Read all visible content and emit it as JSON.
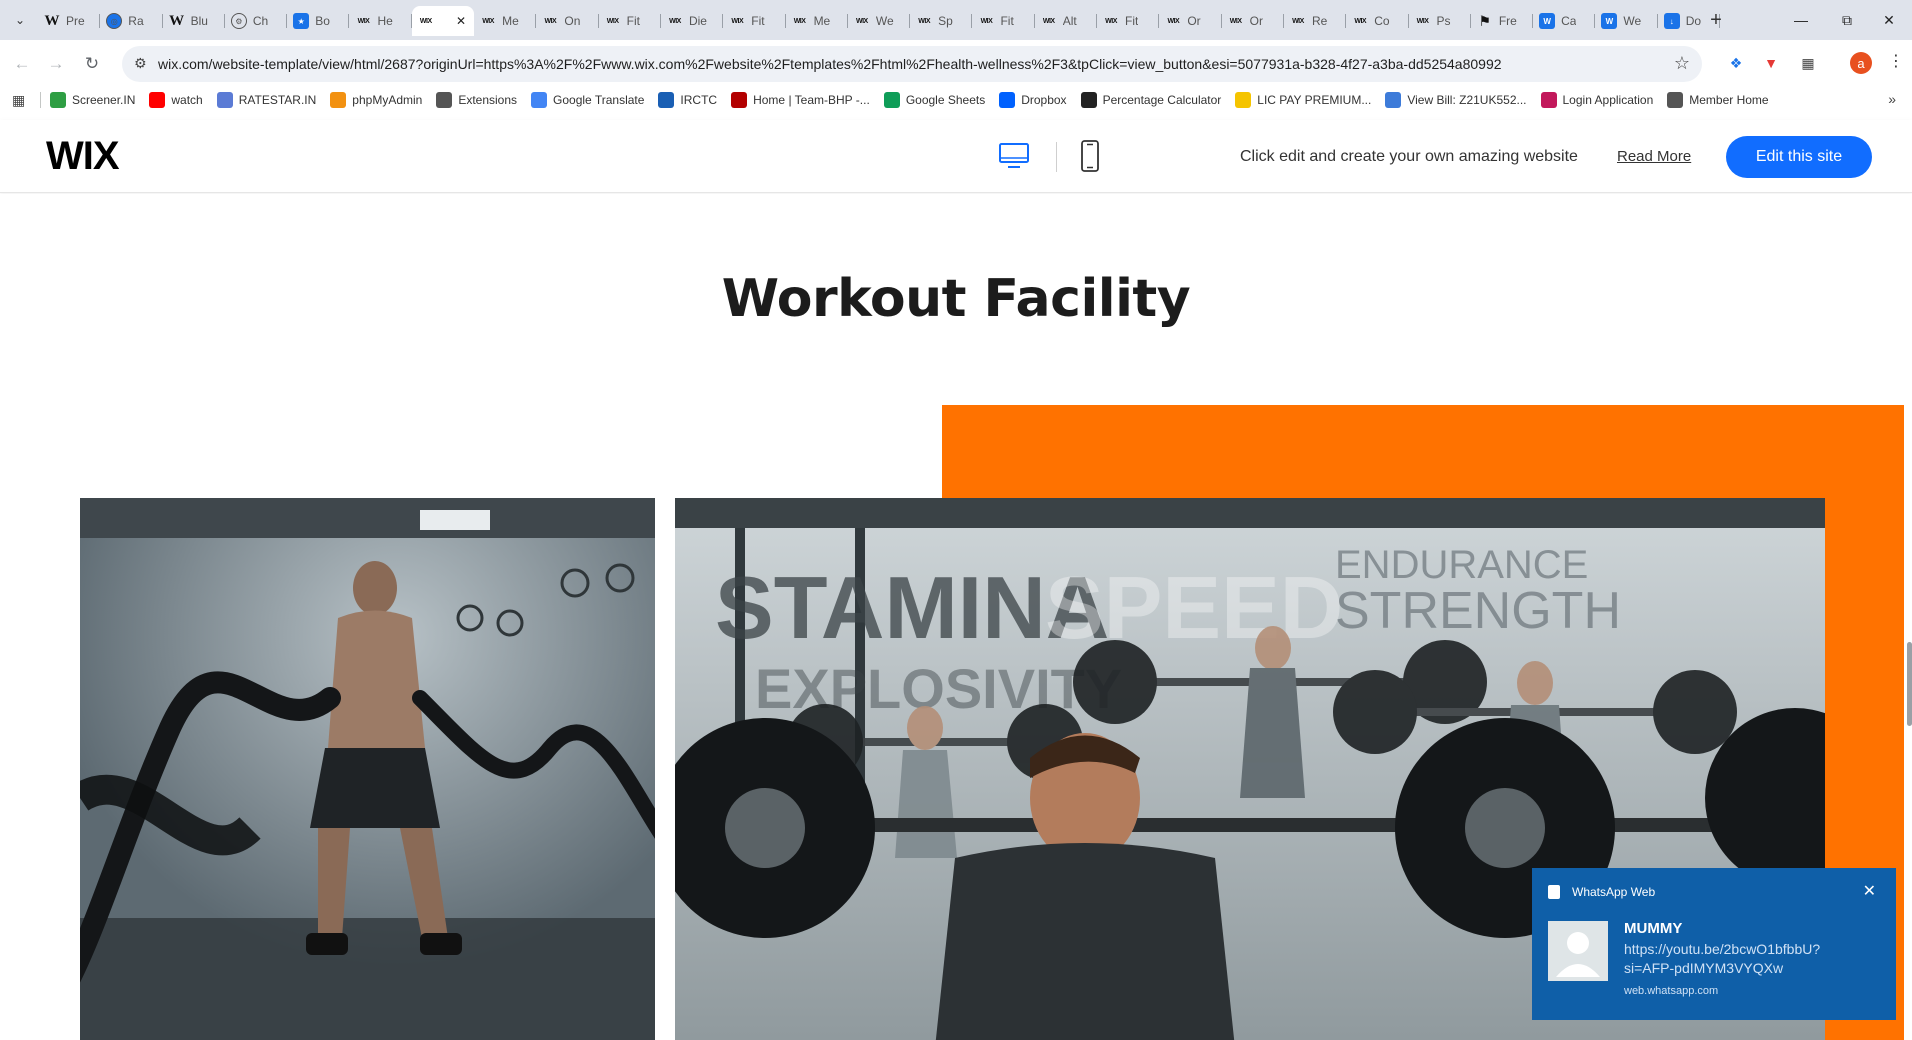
{
  "browser": {
    "tabs": [
      {
        "label": "Pre",
        "icon": "w"
      },
      {
        "label": "Ra",
        "icon": "globe"
      },
      {
        "label": "Blu",
        "icon": "w"
      },
      {
        "label": "Ch",
        "icon": "chatgpt"
      },
      {
        "label": "Bo",
        "icon": "star"
      },
      {
        "label": "He",
        "icon": "wix"
      },
      {
        "label": "",
        "icon": "wix",
        "active": true
      },
      {
        "label": "Me",
        "icon": "wix"
      },
      {
        "label": "On",
        "icon": "wix"
      },
      {
        "label": "Fit",
        "icon": "wix"
      },
      {
        "label": "Die",
        "icon": "wix"
      },
      {
        "label": "Fit",
        "icon": "wix"
      },
      {
        "label": "Me",
        "icon": "wix"
      },
      {
        "label": "We",
        "icon": "wix"
      },
      {
        "label": "Sp",
        "icon": "wix"
      },
      {
        "label": "Fit",
        "icon": "wix"
      },
      {
        "label": "Alt",
        "icon": "wix"
      },
      {
        "label": "Fit",
        "icon": "wix"
      },
      {
        "label": "Or",
        "icon": "wix"
      },
      {
        "label": "Or",
        "icon": "wix"
      },
      {
        "label": "Re",
        "icon": "wix"
      },
      {
        "label": "Co",
        "icon": "wix"
      },
      {
        "label": "Ps",
        "icon": "wix"
      },
      {
        "label": "Fre",
        "icon": "flag"
      },
      {
        "label": "Ca",
        "icon": "word"
      },
      {
        "label": "We",
        "icon": "word"
      },
      {
        "label": "Do",
        "icon": "download"
      }
    ],
    "url": "wix.com/website-template/view/html/2687?originUrl=https%3A%2F%2Fwww.wix.com%2Fwebsite%2Ftemplates%2Fhtml%2Fhealth-wellness%2F3&tpClick=view_button&esi=5077931a-b328-4f27-a3ba-dd5254a80992",
    "profile_initial": "a",
    "bookmarks": [
      {
        "label": "Screener.IN",
        "color": "#2e9e43"
      },
      {
        "label": "watch",
        "color": "#ff0000"
      },
      {
        "label": "RATESTAR.IN",
        "color": "#5b7bd5"
      },
      {
        "label": "phpMyAdmin",
        "color": "#f29111"
      },
      {
        "label": "Extensions",
        "color": "#555555"
      },
      {
        "label": "Google Translate",
        "color": "#4285f4"
      },
      {
        "label": "IRCTC",
        "color": "#1a5fb4"
      },
      {
        "label": "Home | Team-BHP -...",
        "color": "#b30000"
      },
      {
        "label": "Google Sheets",
        "color": "#0f9d58"
      },
      {
        "label": "Dropbox",
        "color": "#0061fe"
      },
      {
        "label": "Percentage Calculator",
        "color": "#222222"
      },
      {
        "label": "LIC PAY PREMIUM...",
        "color": "#f5c400"
      },
      {
        "label": "View Bill: Z21UK552...",
        "color": "#3d7bd9"
      },
      {
        "label": "Login Application",
        "color": "#c2185b"
      },
      {
        "label": "Member Home",
        "color": "#555555"
      }
    ]
  },
  "wix_bar": {
    "logo": "WIX",
    "promo_text": "Click edit and create your own amazing website",
    "read_more": "Read More",
    "edit_button": "Edit this site",
    "accent_color": "#116dff"
  },
  "page": {
    "heading": "Workout Facility",
    "accent_color": "#ff7200",
    "wall_text": [
      "STAMINA",
      "SPEED",
      "ENDURANCE",
      "STRENGTH",
      "EXPLOSIVITY"
    ]
  },
  "notification": {
    "app": "WhatsApp Web",
    "sender": "MUMMY",
    "message": "https://youtu.be/2bcwO1bfbbU?si=AFP-pdIMYM3VYQXw",
    "source": "web.whatsapp.com"
  }
}
